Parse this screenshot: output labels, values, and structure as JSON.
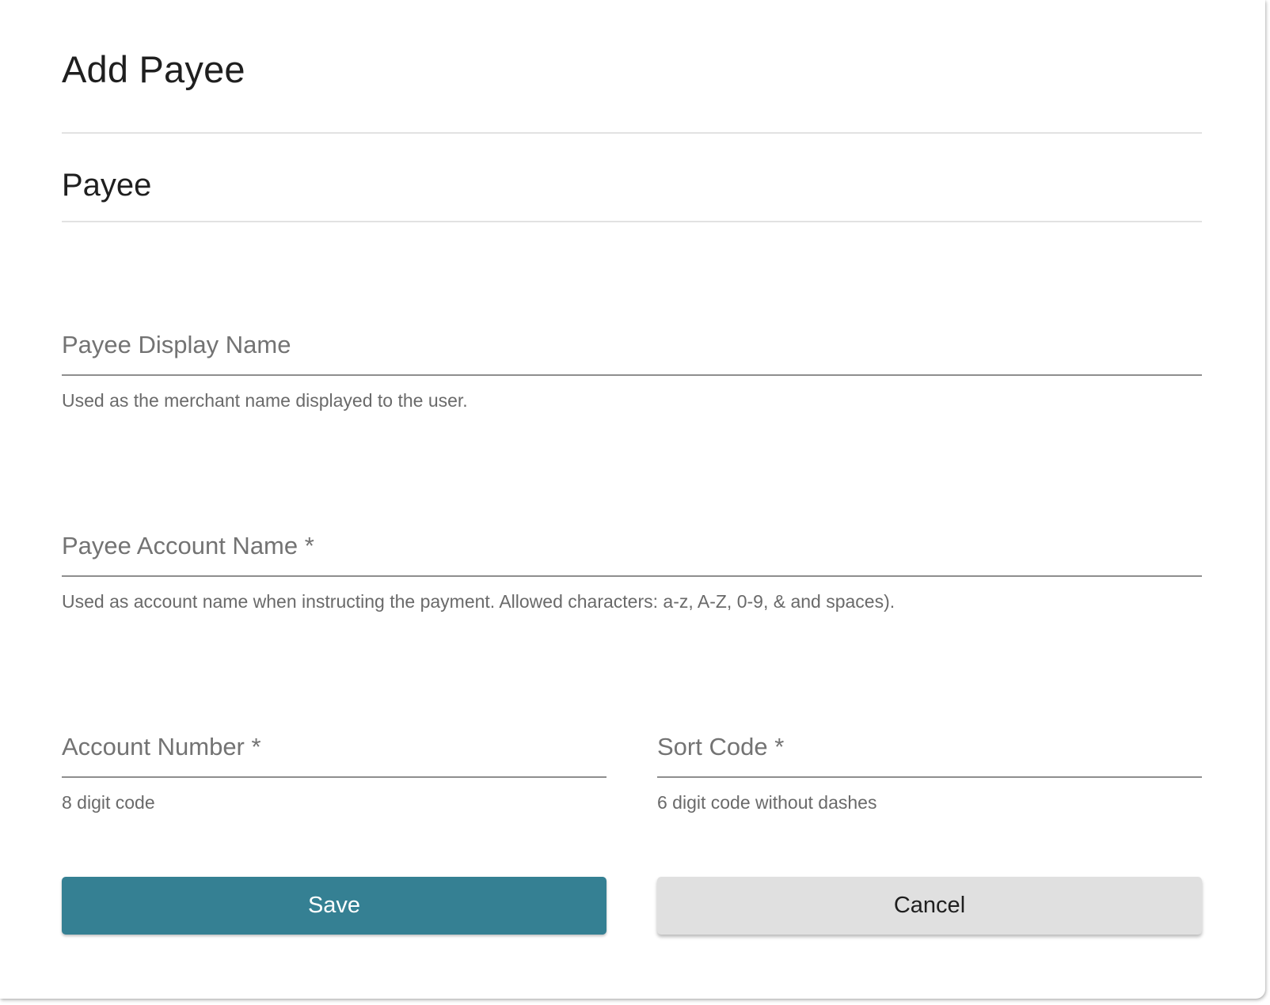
{
  "header": {
    "title": "Add Payee"
  },
  "section": {
    "title": "Payee"
  },
  "form": {
    "payee_display_name": {
      "label": "Payee Display Name",
      "value": "",
      "helper": "Used as the merchant name displayed to the user."
    },
    "payee_account_name": {
      "label": "Payee Account Name *",
      "value": "",
      "helper": "Used as account name when instructing the payment. Allowed characters: a-z, A-Z, 0-9, & and spaces)."
    },
    "account_number": {
      "label": "Account Number *",
      "value": "",
      "helper": "8 digit code"
    },
    "sort_code": {
      "label": "Sort Code *",
      "value": "",
      "helper": "6 digit code without dashes"
    }
  },
  "actions": {
    "save_label": "Save",
    "cancel_label": "Cancel"
  },
  "colors": {
    "primary": "#358093",
    "secondary": "#e0e0e0"
  }
}
